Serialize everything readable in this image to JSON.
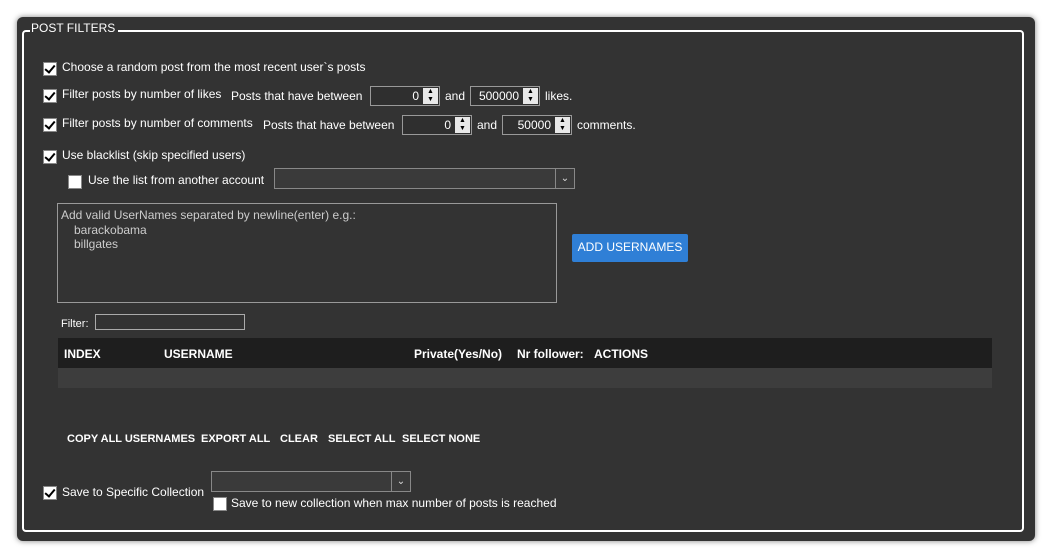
{
  "group_title": "POST FILTERS",
  "random_post": {
    "label": "Choose a random post from the most recent user`s posts",
    "checked": true
  },
  "likes": {
    "label": "Filter posts by number of likes",
    "checked": true,
    "between": "Posts that have between",
    "min": "0",
    "and": "and",
    "max": "500000",
    "unit": "likes."
  },
  "comments": {
    "label": "Filter posts by number of comments",
    "checked": true,
    "between": "Posts that have between",
    "min": "0",
    "and": "and",
    "max": "50000",
    "unit": "comments."
  },
  "blacklist": {
    "label": "Use blacklist (skip specified users)",
    "checked": true
  },
  "other_account": {
    "label": "Use the list from another account",
    "checked": false,
    "value": ""
  },
  "usernames_box": {
    "hint": "Add valid UserNames separated by newline(enter) e.g.:",
    "examples": [
      "barackobama",
      "billgates"
    ]
  },
  "add_button": "ADD USERNAMES",
  "filter_label": "Filter:",
  "table": {
    "columns": [
      "INDEX",
      "USERNAME",
      "Private(Yes/No)",
      "Nr follower:",
      "ACTIONS"
    ],
    "rows": []
  },
  "actions": [
    "COPY ALL USERNAMES",
    "EXPORT ALL",
    "CLEAR",
    "SELECT ALL",
    "SELECT NONE"
  ],
  "collection": {
    "label": "Save to Specific Collection",
    "checked": true,
    "value": ""
  },
  "new_collection": {
    "label": "Save to new collection when max number of posts is reached",
    "checked": false
  },
  "colors": {
    "background": "#333333",
    "accent": "#2f7fd6",
    "header": "#1e1e1e"
  }
}
